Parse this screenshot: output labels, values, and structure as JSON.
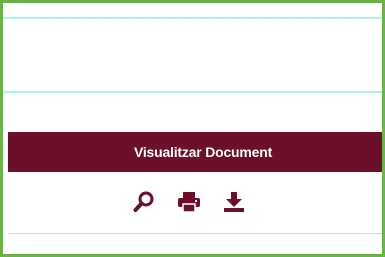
{
  "document_panel": {
    "header_label": "Visualitzar Document",
    "colors": {
      "header_background": "#6b1028",
      "header_text": "#ffffff",
      "icon_color": "#6b1028",
      "frame_border": "#6bb24a",
      "guide_lines": "#a9f1ec"
    },
    "actions": [
      {
        "icon": "search-icon"
      },
      {
        "icon": "print-icon"
      },
      {
        "icon": "download-icon"
      }
    ]
  }
}
